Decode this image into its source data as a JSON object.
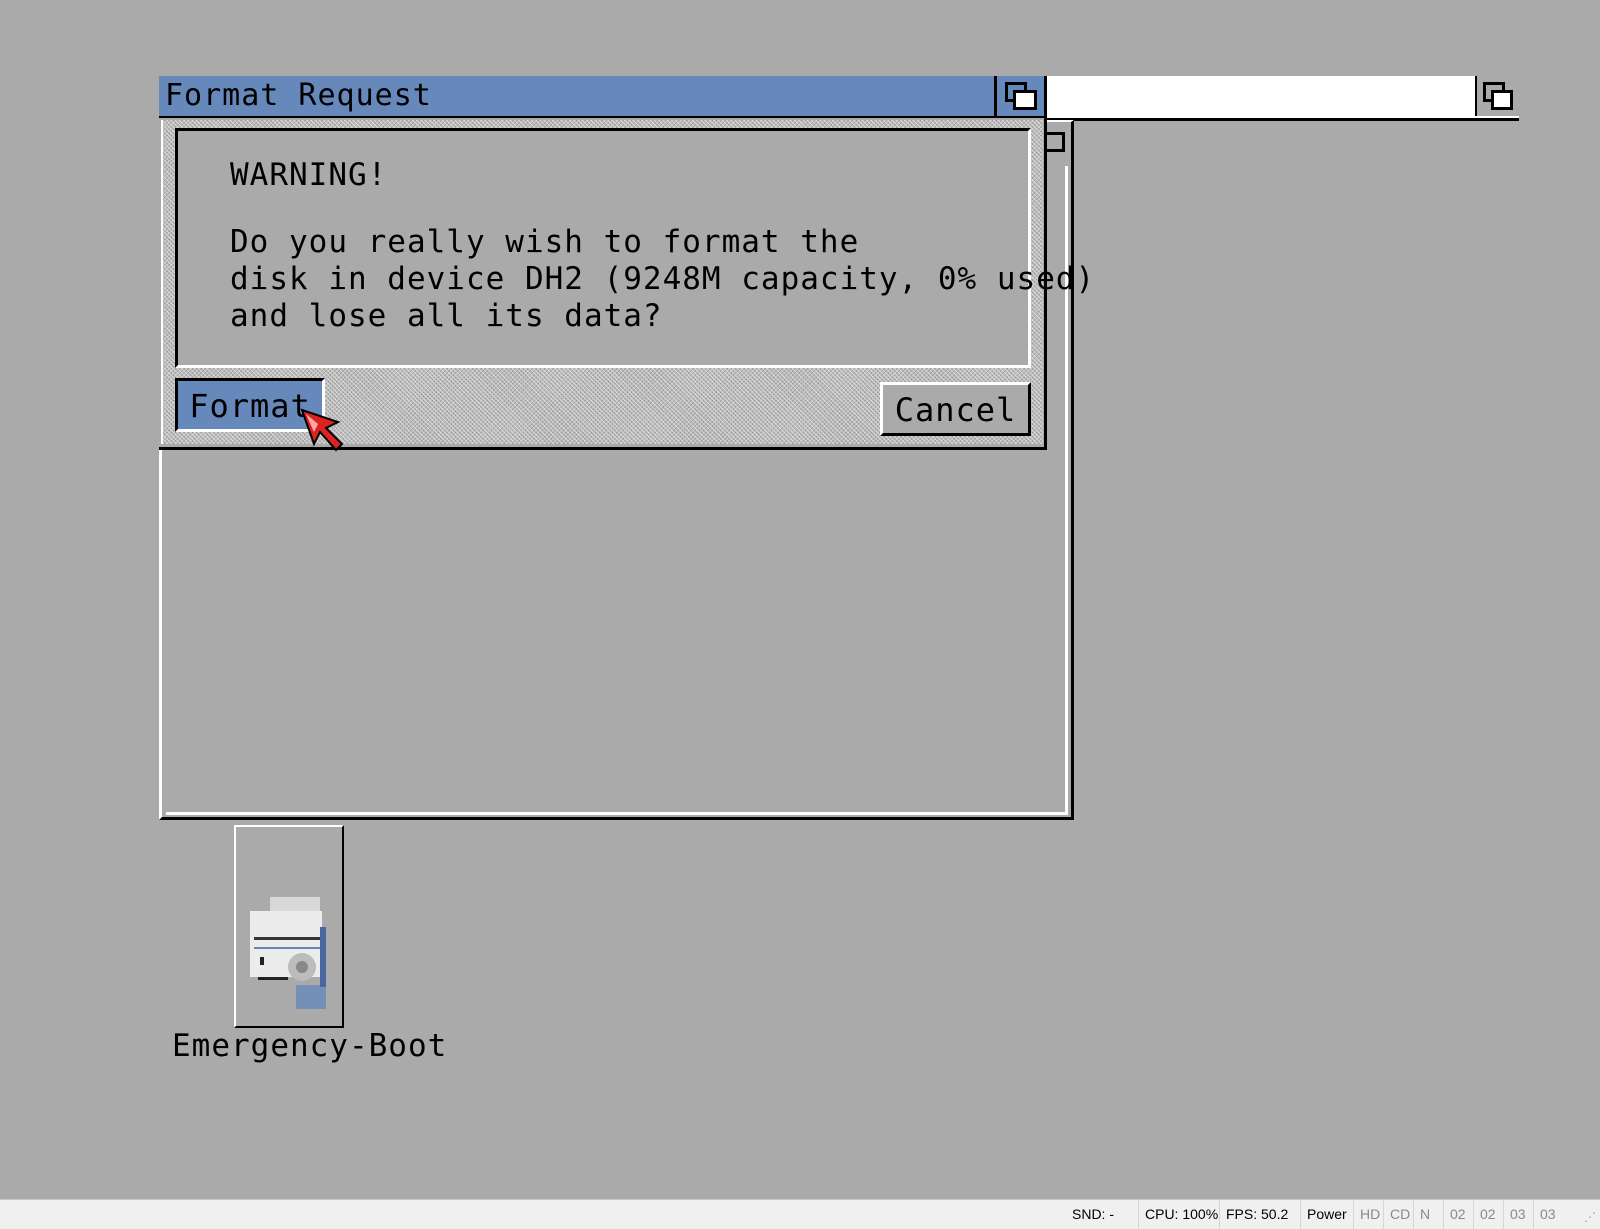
{
  "requester": {
    "title": "Format Request",
    "heading": "WARNING!",
    "lines": [
      "Do you really wish to format the",
      "disk in device DH2 (9248M capacity, 0% used)",
      "and lose all its data?"
    ],
    "format_label": "Format",
    "cancel_label": "Cancel"
  },
  "desktop": {
    "icon_label": "Emergency-Boot"
  },
  "statusbar": {
    "snd": "SND: -",
    "cpu": "CPU: 100%",
    "fps": "FPS: 50.2",
    "power": "Power",
    "hd": "HD",
    "cd": "CD",
    "n": "N",
    "track0": "02",
    "track1": "02",
    "track2": "03",
    "track3": "03"
  },
  "colors": {
    "background": "#aaaaaa",
    "accent": "#6688bb"
  }
}
